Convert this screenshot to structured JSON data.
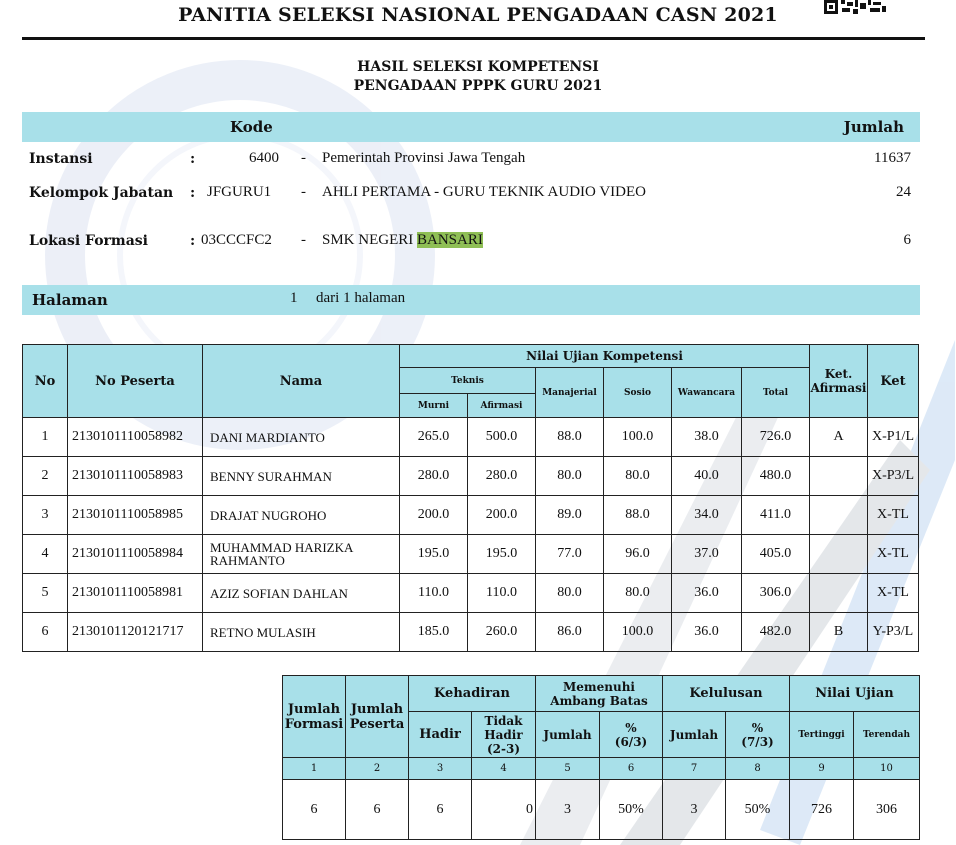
{
  "header": {
    "title": "PANITIA SELEKSI NASIONAL PENGADAAN CASN 2021",
    "subtitle_1": "HASIL SELEKSI KOMPETENSI",
    "subtitle_2": "PENGADAAN PPPK GURU 2021"
  },
  "info": {
    "kode_label": "Kode",
    "jumlah_label": "Jumlah",
    "instansi": {
      "label": "Instansi",
      "sep": ":",
      "code": "6400",
      "dash": "-",
      "name": "Pemerintah Provinsi Jawa Tengah",
      "count": "11637"
    },
    "kelompok": {
      "label": "Kelompok Jabatan",
      "sep": ":",
      "code": "JFGURU1",
      "dash": "-",
      "name": "AHLI PERTAMA - GURU TEKNIK AUDIO VIDEO",
      "count": "24"
    },
    "lokasi": {
      "label": "Lokasi Formasi",
      "sep": ":",
      "code": "03CCCFC2",
      "dash": "-",
      "name_prefix": "SMK NEGERI ",
      "name_highlight": "BANSARI",
      "count": "6"
    }
  },
  "halaman": {
    "label": "Halaman",
    "current": "1",
    "text": "dari 1 halaman"
  },
  "results_table": {
    "headers": {
      "no": "No",
      "no_peserta": "No Peserta",
      "nama": "Nama",
      "nilai": "Nilai Ujian Kompetensi",
      "teknis": "Teknis",
      "murni": "Murni",
      "afirmasi": "Afirmasi",
      "manajerial": "Manajerial",
      "sosio": "Sosio",
      "wawancara": "Wawancara",
      "total": "Total",
      "ket_afirmasi_1": "Ket.",
      "ket_afirmasi_2": "Afirmasi",
      "ket": "Ket"
    },
    "rows": [
      {
        "no": "1",
        "peserta": "2130101110058982",
        "nama": "DANI MARDIANTO",
        "murni": "265.0",
        "afirmasi": "500.0",
        "manajerial": "88.0",
        "sosio": "100.0",
        "wawancara": "38.0",
        "total": "726.0",
        "ket_afirmasi": "A",
        "ket": "X-P1/L"
      },
      {
        "no": "2",
        "peserta": "2130101110058983",
        "nama": "BENNY SURAHMAN",
        "murni": "280.0",
        "afirmasi": "280.0",
        "manajerial": "80.0",
        "sosio": "80.0",
        "wawancara": "40.0",
        "total": "480.0",
        "ket_afirmasi": "",
        "ket": "X-P3/L"
      },
      {
        "no": "3",
        "peserta": "2130101110058985",
        "nama": "DRAJAT NUGROHO",
        "murni": "200.0",
        "afirmasi": "200.0",
        "manajerial": "89.0",
        "sosio": "88.0",
        "wawancara": "34.0",
        "total": "411.0",
        "ket_afirmasi": "",
        "ket": "X-TL"
      },
      {
        "no": "4",
        "peserta": "2130101110058984",
        "nama": "MUHAMMAD HARIZKA RAHMANTO",
        "murni": "195.0",
        "afirmasi": "195.0",
        "manajerial": "77.0",
        "sosio": "96.0",
        "wawancara": "37.0",
        "total": "405.0",
        "ket_afirmasi": "",
        "ket": "X-TL"
      },
      {
        "no": "5",
        "peserta": "2130101110058981",
        "nama": "AZIZ SOFIAN DAHLAN",
        "murni": "110.0",
        "afirmasi": "110.0",
        "manajerial": "80.0",
        "sosio": "80.0",
        "wawancara": "36.0",
        "total": "306.0",
        "ket_afirmasi": "",
        "ket": "X-TL"
      },
      {
        "no": "6",
        "peserta": "2130101120121717",
        "nama": "RETNO MULASIH",
        "murni": "185.0",
        "afirmasi": "260.0",
        "manajerial": "86.0",
        "sosio": "100.0",
        "wawancara": "36.0",
        "total": "482.0",
        "ket_afirmasi": "B",
        "ket": "Y-P3/L"
      }
    ]
  },
  "summary_table": {
    "headers": {
      "jumlah_formasi_1": "Jumlah",
      "jumlah_formasi_2": "Formasi",
      "jumlah_peserta_1": "Jumlah",
      "jumlah_peserta_2": "Peserta",
      "kehadiran": "Kehadiran",
      "hadir": "Hadir",
      "tidak_hadir_1": "Tidak",
      "tidak_hadir_2": "Hadir",
      "tidak_hadir_3": "(2-3)",
      "ambang_1": "Memenuhi",
      "ambang_2": "Ambang Batas",
      "jumlah": "Jumlah",
      "pct_a": "%",
      "pct_a_2": "(6/3)",
      "kelulusan": "Kelulusan",
      "jumlah_2": "Jumlah",
      "pct_b": "%",
      "pct_b_2": "(7/3)",
      "nilai_ujian": "Nilai Ujian",
      "tertinggi": "Tertinggi",
      "terendah": "Terendah"
    },
    "col_numbers": [
      "1",
      "2",
      "3",
      "4",
      "5",
      "6",
      "7",
      "8",
      "9",
      "10"
    ],
    "values": [
      "6",
      "6",
      "6",
      "0",
      "3",
      "50%",
      "3",
      "50%",
      "726",
      "306"
    ]
  },
  "colors": {
    "header_fill": "#a8e0e9",
    "highlight": "#8fbf55",
    "watermark": "#d6dff0"
  }
}
